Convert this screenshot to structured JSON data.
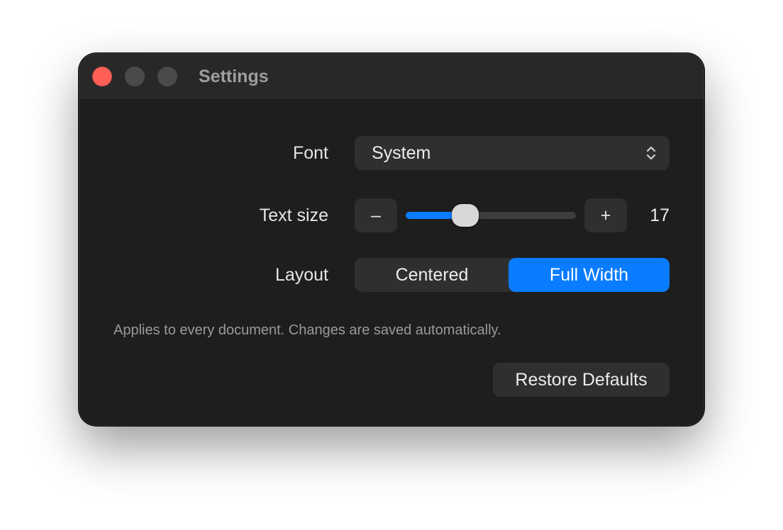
{
  "window": {
    "title": "Settings"
  },
  "settings": {
    "font": {
      "label": "Font",
      "value": "System",
      "icon": "chevron-up-down-icon"
    },
    "text_size": {
      "label": "Text size",
      "decrement_label": "–",
      "increment_label": "+",
      "value": "17",
      "slider_fraction": 0.35
    },
    "layout": {
      "label": "Layout",
      "options": [
        "Centered",
        "Full Width"
      ],
      "selected": "Full Width"
    }
  },
  "note": "Applies to every document. Changes are saved automatically.",
  "restore_label": "Restore Defaults",
  "colors": {
    "accent": "#0a7cff",
    "close": "#ff5f57",
    "window_bg": "#1e1e1e",
    "control_bg": "#2f2f2f"
  }
}
